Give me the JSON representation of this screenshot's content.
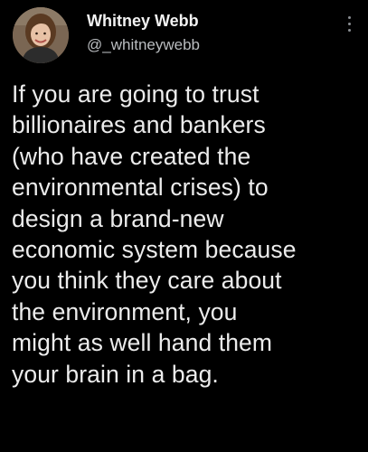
{
  "tweet": {
    "author": {
      "display_name": "Whitney Webb",
      "handle": "@_whitneywebb",
      "avatar_icon": "profile-photo"
    },
    "more_icon": "more-options-vertical-icon",
    "text_lines": [
      "If you are going to trust",
      "billionaires and bankers",
      "(who have created the",
      "environmental crises) to",
      "design a brand-new",
      "economic system because",
      "you think they care about",
      "the environment, you",
      "might as well hand them",
      "your brain in a bag."
    ]
  },
  "colors": {
    "background": "#000000",
    "text": "#ececec",
    "secondary_text": "#b9bcbf"
  }
}
